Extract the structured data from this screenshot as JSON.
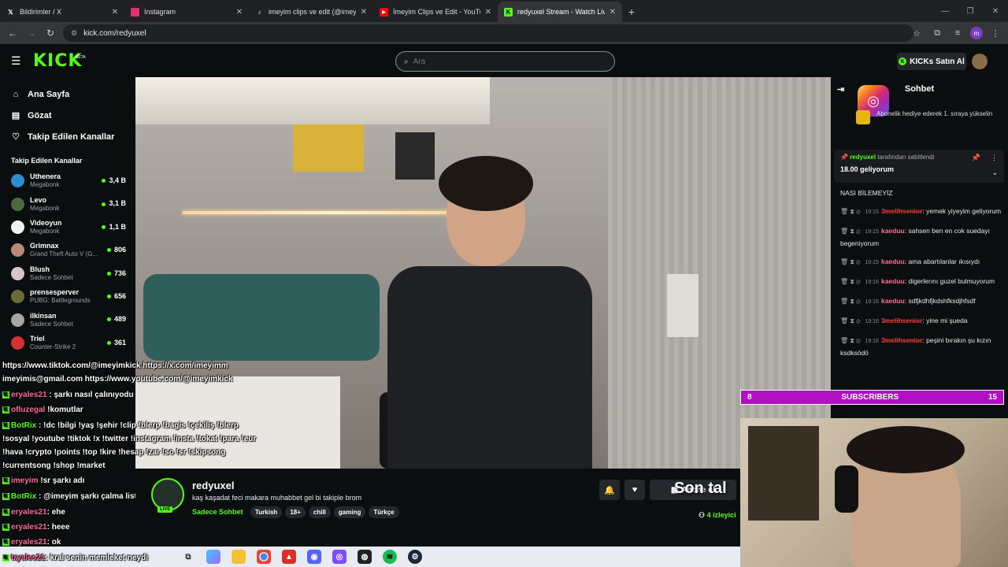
{
  "browser": {
    "tabs": [
      {
        "title": "Bildirimler / X",
        "icon": "x-logo-icon",
        "active": false
      },
      {
        "title": "Instagram",
        "icon": "instagram-icon",
        "active": false
      },
      {
        "title": "imeyim clips ve edit (@imeyim",
        "icon": "tiktok-icon",
        "active": false
      },
      {
        "title": "İmeyim Clips ve Edit - YouTube",
        "icon": "youtube-icon",
        "active": false
      },
      {
        "title": "redyuxel Stream - Watch Live o",
        "icon": "kick-icon",
        "active": true
      }
    ],
    "url": "kick.com/redyuxel",
    "profile_initial": "m"
  },
  "header": {
    "logo": "KICK",
    "beta": "BETA",
    "search_placeholder": "Ara",
    "kicks_button": "KICKs Satın Al"
  },
  "sidebar": {
    "nav": [
      {
        "label": "Ana Sayfa",
        "icon": "home-icon"
      },
      {
        "label": "Gözat",
        "icon": "browse-icon"
      },
      {
        "label": "Takip Edilen Kanallar",
        "icon": "heart-icon"
      }
    ],
    "section_title": "Takip Edilen Kanallar",
    "channels": [
      {
        "name": "Uthenera",
        "category": "Megabonk",
        "viewers": "3,4 B",
        "color": "#2a8fd0"
      },
      {
        "name": "Levo",
        "category": "Megabonk",
        "viewers": "3,1 B",
        "color": "#4a6b3c"
      },
      {
        "name": "Videoyun",
        "category": "Megabonk",
        "viewers": "1,1 B",
        "color": "#f1f1f1"
      },
      {
        "name": "Grimnax",
        "category": "Grand Theft Auto V (G...",
        "viewers": "806",
        "color": "#b98878"
      },
      {
        "name": "Blush",
        "category": "Sadece Sohbet",
        "viewers": "736",
        "color": "#d7c3c9"
      },
      {
        "name": "prensesperver",
        "category": "PUBG: Battlegrounds",
        "viewers": "656",
        "color": "#6b6b3a"
      },
      {
        "name": "ilkinsan",
        "category": "Sadece Sohbet",
        "viewers": "489",
        "color": "#a9a6a6"
      },
      {
        "name": "Triel",
        "category": "Counter-Strike 2",
        "viewers": "361",
        "color": "#d23232"
      }
    ]
  },
  "overlay": {
    "lines": [
      "https://www.tiktok.com/@imeyimkick https://x.com/imeyimm",
      "imeyimis@gmail.com https://www.youtube.com/@imeyimkick",
      ": şarkı nasıl çalınıyodu",
      "!komutlar",
      "BotRix",
      ": !dc !bilgi !yaş !şehir !clip !blerp !bagis !çekiliş !blerp",
      "!sosyal !youtube !tiktok !x !twitter !instagram !insta !tokat !para !eur",
      "!hava !crypto !points !top !kire !hesap !zar !so !sr !skipsong",
      "!currentsong !shop !market",
      "!sr şarkı adı",
      ": @imeyim şarkı çalma listesine eklenemedi",
      ": ehe",
      ": heee",
      ": ok",
      ": kral senin memleket neydi"
    ],
    "usernames": [
      "eryales21",
      "ofluzegal",
      "imeyim",
      "BotRix",
      "eryales21",
      "eryales21",
      "eryales21",
      "tryales21"
    ],
    "cam_text": "Son tal"
  },
  "stream": {
    "channel": "redyuxel",
    "title": "kaş kaşadat feci makara muhabbet gel bi takiple brom",
    "category": "Sadece Sohbet",
    "tags": [
      "Turkish",
      "18+",
      "chill",
      "gaming",
      "Türkçe"
    ],
    "viewers": "4 izleyici",
    "live": "LIVE",
    "subscribe_label": "Abone ol"
  },
  "chat": {
    "title": "Sohbet",
    "gift_tip": "Abonelik hediye ederek 1. sıraya yükselin",
    "pinned_by_user": "redyuxel",
    "pinned_by_suffix": "tarafından sabitlendi",
    "pinned_message": "18.00 geliyorum",
    "messages": [
      {
        "time": "",
        "user": "",
        "text": "NASI BİLEMEYİZ"
      },
      {
        "time": "19:15",
        "user": "3melihsenior",
        "text": "yemek yiyeyim geliyorum",
        "color": "red"
      },
      {
        "time": "19:15",
        "user": "kaeduu",
        "text": "sahsen ben en cok suedayı begeniyorum",
        "color": "pink"
      },
      {
        "time": "19:15",
        "user": "kaeduu",
        "text": "ama abartılanlar ıkısıydı",
        "color": "pink"
      },
      {
        "time": "19:16",
        "user": "kaeduu",
        "text": "digerlerını guzel bulmuyorum",
        "color": "pink"
      },
      {
        "time": "19:16",
        "user": "kaeduu",
        "text": "sdfjkdhfjkdshfksdjhfsdf",
        "color": "pink"
      },
      {
        "time": "19:16",
        "user": "3melihsenior",
        "text": "yine mi şueda",
        "color": "red"
      },
      {
        "time": "19:16",
        "user": "3melihsenior",
        "text": "peşini bırakın şu kızın ksdksödö",
        "color": "red"
      }
    ],
    "sub_goal": {
      "current": "8",
      "label": "SUBSCRIBERS",
      "target": "15"
    }
  },
  "taskbar": {
    "icons": [
      "file-explorer-icon",
      "copilot-icon",
      "edge-icon",
      "chrome-icon",
      "app-icon",
      "discord-icon",
      "obs-icon",
      "steam-icon",
      "spotify-icon"
    ]
  },
  "colors": {
    "accent": "#53fc18",
    "sub_bar": "#b10fc2"
  }
}
